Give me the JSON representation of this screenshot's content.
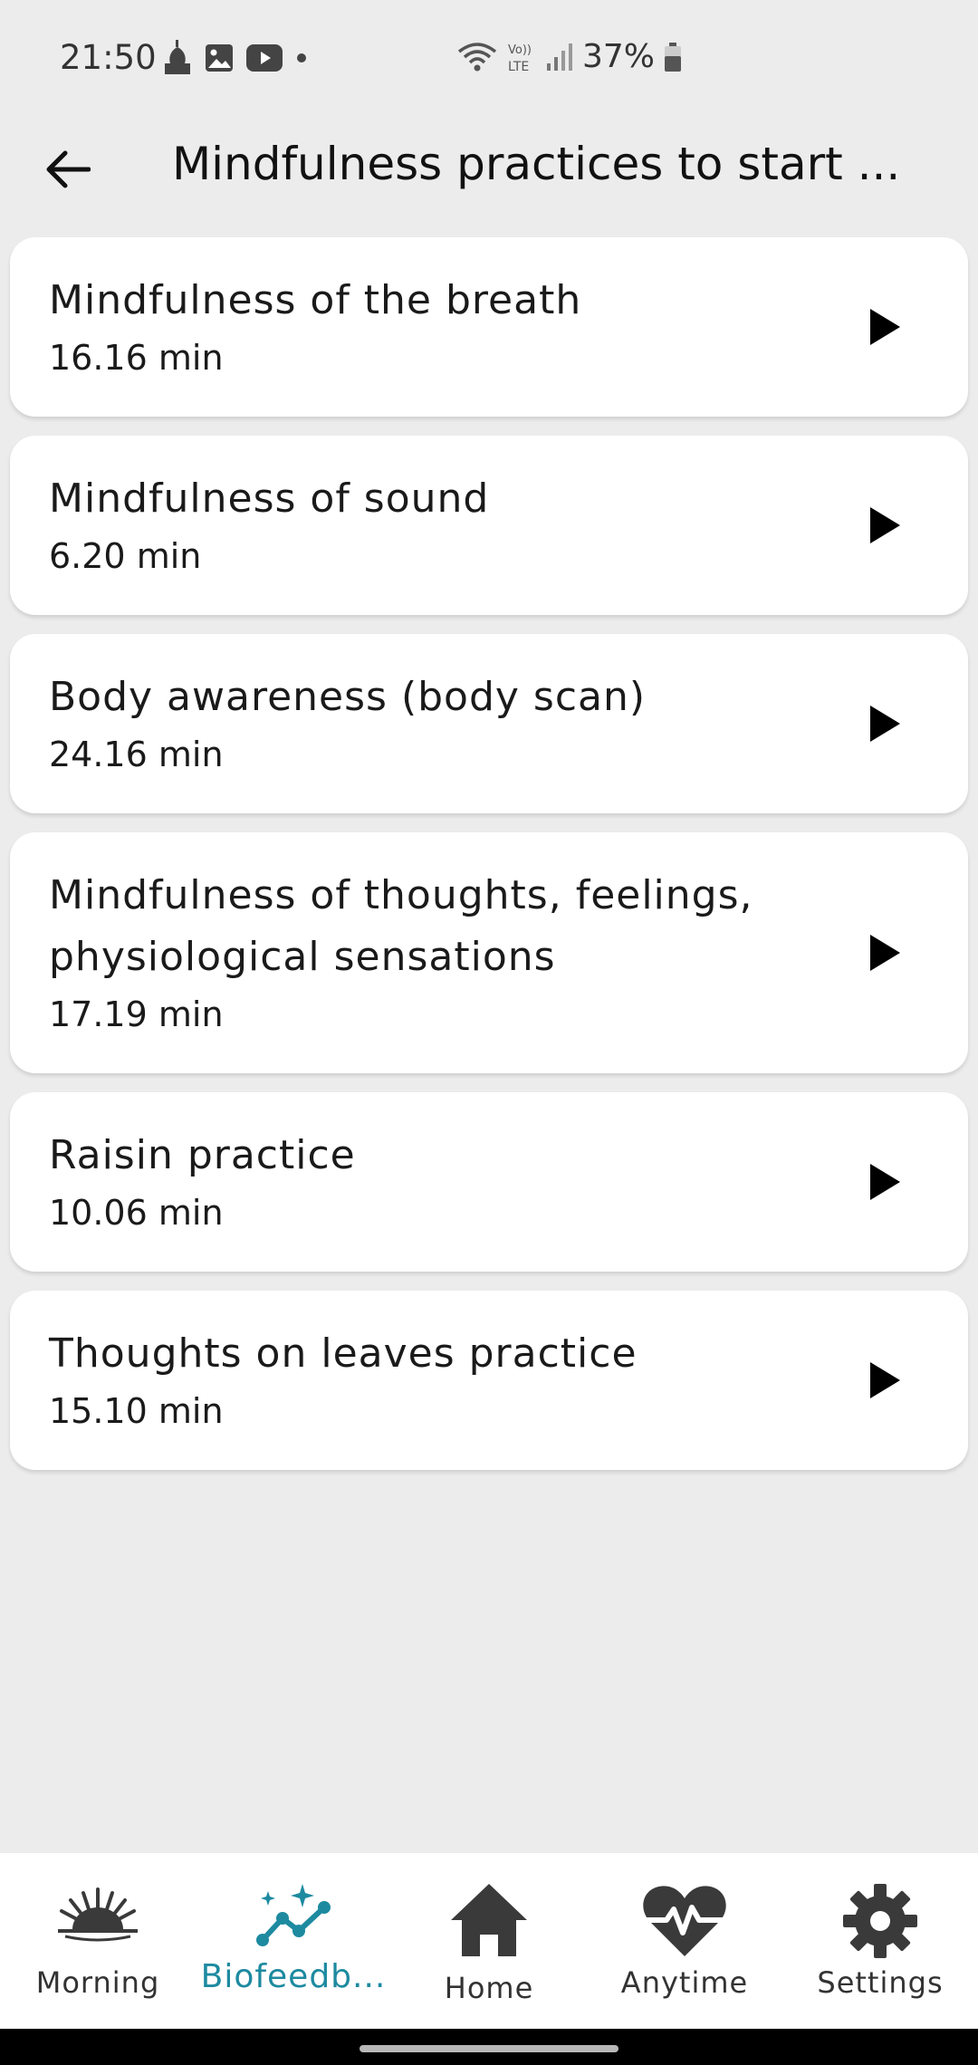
{
  "status_bar": {
    "time": "21:50",
    "battery": "37%",
    "left_icons": [
      "mosque-notification-icon",
      "gallery-icon",
      "youtube-icon",
      "dot-icon"
    ],
    "right_icons": [
      "wifi-icon",
      "volte-icon",
      "signal-icon",
      "battery-icon"
    ]
  },
  "header": {
    "title": "Mindfulness practices to start ...",
    "back_icon": "arrow-left-icon"
  },
  "practices": [
    {
      "title": "Mindfulness of the breath",
      "duration": "16.16 min"
    },
    {
      "title": "Mindfulness of sound",
      "duration": "6.20 min"
    },
    {
      "title": "Body awareness (body scan)",
      "duration": "24.16 min"
    },
    {
      "title": "Mindfulness of thoughts, feelings, physiological sensations",
      "duration": "17.19 min"
    },
    {
      "title": "Raisin practice",
      "duration": "10.06 min"
    },
    {
      "title": "Thoughts on leaves practice",
      "duration": "15.10 min"
    }
  ],
  "bottom_nav": {
    "items": [
      {
        "label": "Morning",
        "icon": "sunrise-icon",
        "active": false
      },
      {
        "label": "Biofeedb...",
        "icon": "trend-chart-icon",
        "active": true
      },
      {
        "label": "Home",
        "icon": "home-icon",
        "active": false
      },
      {
        "label": "Anytime",
        "icon": "heart-pulse-icon",
        "active": false
      },
      {
        "label": "Settings",
        "icon": "gear-icon",
        "active": false
      }
    ]
  },
  "colors": {
    "accent": "#1d8aa0",
    "background": "#ececec",
    "card": "#ffffff",
    "icon": "#3a3a3a"
  }
}
